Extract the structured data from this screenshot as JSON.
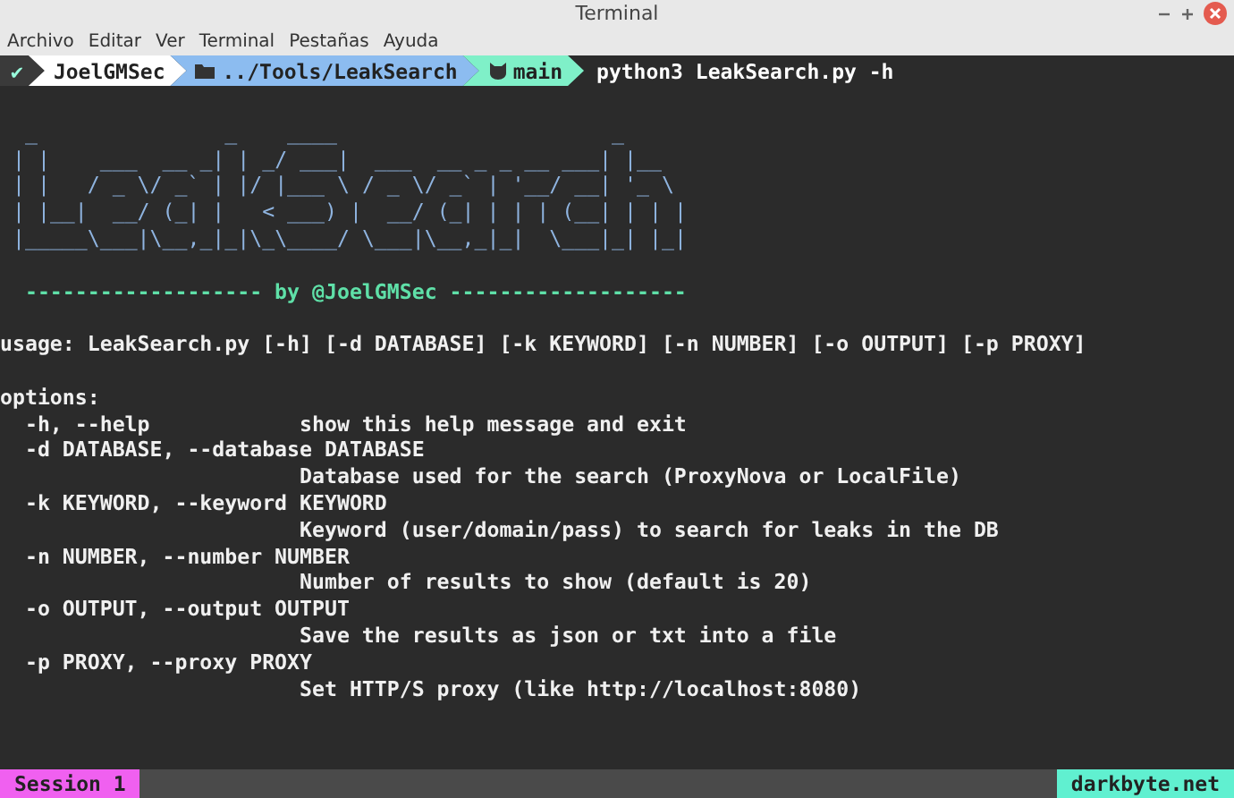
{
  "window": {
    "title": "Terminal"
  },
  "menu": [
    "Archivo",
    "Editar",
    "Ver",
    "Terminal",
    "Pestañas",
    "Ayuda"
  ],
  "prompt": {
    "status": "✔",
    "user": "JoelGMSec",
    "path": "../Tools/LeakSearch",
    "branch": "main",
    "command": "python3 LeakSearch.py -h"
  },
  "banner": {
    "art": [
      " _               _    ____                      _",
      "| |    ___  __ _| | _/ ___|  ___  __ _ _ __ ___| |__",
      "| |   / _ \\/ _` | |/ |___ \\ / _ \\/ _` | '__/ __| '_ \\",
      "| |__|  __/ (_| |   < ___) |  __/ (_| | | | (__| | | |",
      "|_____\\___|\\__,_|_|\\_\\____/ \\___|\\__,_|_|  \\___|_| |_|"
    ],
    "byline": "  ------------------- by @JoelGMSec -------------------"
  },
  "usage": "usage: LeakSearch.py [-h] [-d DATABASE] [-k KEYWORD] [-n NUMBER] [-o OUTPUT] [-p PROXY]",
  "options_heading": "options:",
  "options": [
    "  -h, --help            show this help message and exit",
    "  -d DATABASE, --database DATABASE",
    "                        Database used for the search (ProxyNova or LocalFile)",
    "  -k KEYWORD, --keyword KEYWORD",
    "                        Keyword (user/domain/pass) to search for leaks in the DB",
    "  -n NUMBER, --number NUMBER",
    "                        Number of results to show (default is 20)",
    "  -o OUTPUT, --output OUTPUT",
    "                        Save the results as json or txt into a file",
    "  -p PROXY, --proxy PROXY",
    "                        Set HTTP/S proxy (like http://localhost:8080)"
  ],
  "status_bar": {
    "session": "Session 1",
    "host": "darkbyte.net"
  }
}
